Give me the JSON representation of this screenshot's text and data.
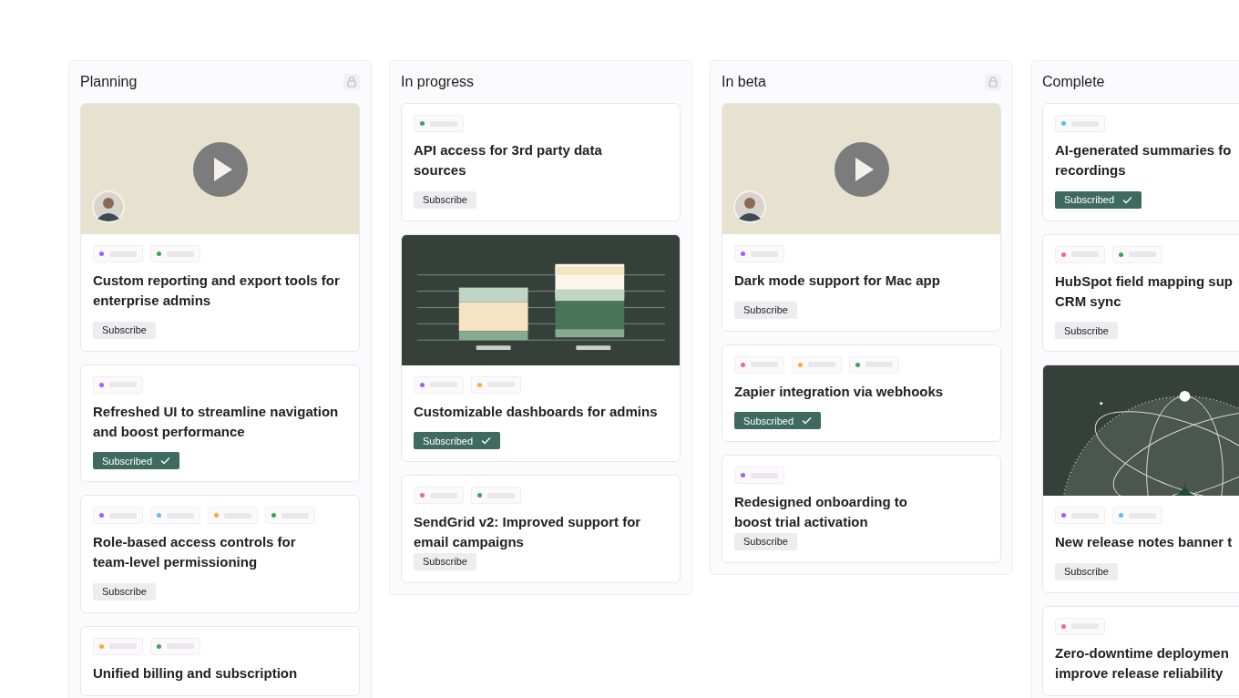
{
  "columns": [
    {
      "title": "Planning",
      "locked": true,
      "cards": [
        {
          "media": {
            "kind": "video"
          },
          "tags": [
            {
              "color": "#a25cff"
            },
            {
              "color": "#3aa655"
            }
          ],
          "title_lines": [
            "Custom reporting and export tools for",
            "enterprise admins"
          ],
          "subscribe": {
            "label": "Subscribe",
            "subscribed": false
          }
        },
        {
          "tags": [
            {
              "color": "#a25cff"
            }
          ],
          "title_lines": [
            "Refreshed UI to streamline navigation",
            "and boost performance"
          ],
          "subscribe": {
            "label": "Subscribed",
            "subscribed": true
          }
        },
        {
          "tags": [
            {
              "color": "#a25cff"
            },
            {
              "color": "#5bc0eb"
            },
            {
              "color": "#f5b12e"
            },
            {
              "color": "#3aa655"
            }
          ],
          "title_lines": [
            "Role-based access controls for",
            "team-level permissioning"
          ],
          "subscribe": {
            "label": "Subscribe",
            "subscribed": false
          }
        },
        {
          "tags": [
            {
              "color": "#f5b12e"
            },
            {
              "color": "#3aa655"
            }
          ],
          "title_lines": [
            "Unified billing and subscription"
          ]
        }
      ]
    },
    {
      "title": "In progress",
      "locked": false,
      "cards": [
        {
          "tags": [
            {
              "color": "#3aa655"
            }
          ],
          "title_lines": [
            "API access for 3rd party data",
            "sources"
          ],
          "subscribe": {
            "label": "Subscribe",
            "subscribed": false
          }
        },
        {
          "media": {
            "kind": "bars"
          },
          "tags": [
            {
              "color": "#a25cff"
            },
            {
              "color": "#f5b12e"
            }
          ],
          "title_lines": [
            "Customizable dashboards for admins"
          ],
          "subscribe": {
            "label": "Subscribed",
            "subscribed": true
          }
        },
        {
          "tags": [
            {
              "color": "#f16b7a"
            },
            {
              "color": "#3aa655"
            }
          ],
          "title_lines": [
            "SendGrid v2: Improved support for",
            "email campaigns"
          ],
          "subscribe": {
            "label": "Subscribe",
            "subscribed": false
          }
        }
      ]
    },
    {
      "title": "In beta",
      "locked": true,
      "cards": [
        {
          "media": {
            "kind": "video"
          },
          "tags": [
            {
              "color": "#a25cff"
            }
          ],
          "title_lines": [
            "Dark mode support for Mac app"
          ],
          "subscribe": {
            "label": "Subscribe",
            "subscribed": false
          }
        },
        {
          "tags": [
            {
              "color": "#f16b7a"
            },
            {
              "color": "#f5b12e"
            },
            {
              "color": "#3aa655"
            }
          ],
          "title_lines": [
            "Zapier integration via webhooks"
          ],
          "subscribe": {
            "label": "Subscribed",
            "subscribed": true
          }
        },
        {
          "tags": [
            {
              "color": "#a25cff"
            }
          ],
          "title_lines": [
            "Redesigned onboarding to",
            "boost trial activation"
          ],
          "subscribe": {
            "label": "Subscribe",
            "subscribed": false
          }
        }
      ]
    },
    {
      "title": "Complete",
      "locked": false,
      "cards": [
        {
          "tags": [
            {
              "color": "#5bc0eb"
            }
          ],
          "title_lines": [
            "AI-generated summaries fo",
            "recordings"
          ],
          "subscribe": {
            "label": "Subscribed",
            "subscribed": true
          }
        },
        {
          "tags": [
            {
              "color": "#f16b7a"
            },
            {
              "color": "#3aa655"
            }
          ],
          "title_lines": [
            "HubSpot field mapping sup",
            "CRM sync"
          ],
          "subscribe": {
            "label": "Subscribe",
            "subscribed": false
          }
        },
        {
          "media": {
            "kind": "orbit"
          },
          "tags": [
            {
              "color": "#a25cff"
            },
            {
              "color": "#5bc0eb"
            }
          ],
          "title_lines": [
            "New release notes banner t"
          ],
          "subscribe": {
            "label": "Subscribe",
            "subscribed": false
          }
        },
        {
          "tags": [
            {
              "color": "#f16b7a"
            }
          ],
          "title_lines": [
            "Zero-downtime deploymen",
            "improve release reliability"
          ]
        }
      ]
    }
  ]
}
